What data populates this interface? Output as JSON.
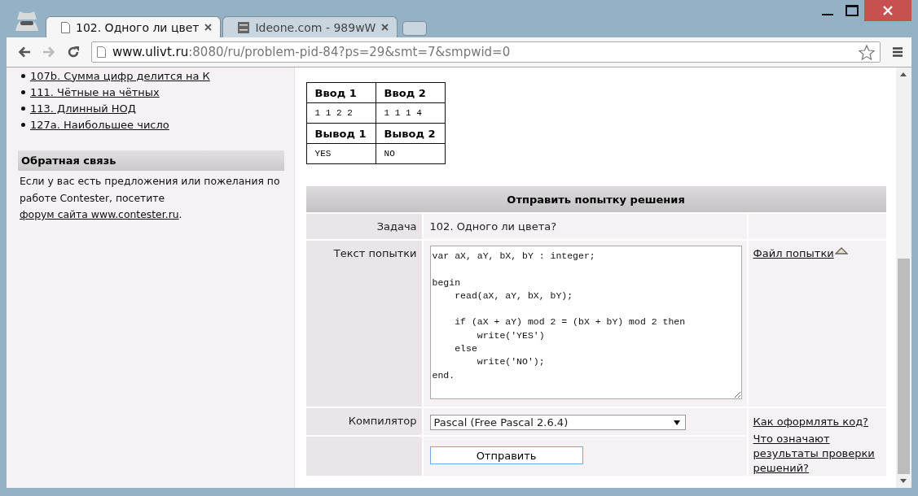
{
  "tabs": [
    {
      "title": "102. Одного ли цвет",
      "selected": true,
      "kind": "page"
    },
    {
      "title": "Ideone.com - 989wW",
      "selected": false,
      "kind": "ideone"
    }
  ],
  "address": {
    "host": "www.ulivt.ru",
    "rest": ":8080/ru/problem-pid-84?ps=29&smt=7&smpwid=0"
  },
  "sidebar": {
    "links": [
      "107b. Сумма цифр делится на К",
      "111. Чётные на чётных",
      "113. Длинный НОД",
      "127a. Наибольшее число"
    ],
    "feedback": {
      "title": "Обратная связь",
      "before": "Если у вас есть предложения или пожелания по работе Contester, посетите ",
      "link": "форум сайта www.contester.ru",
      "after": "."
    }
  },
  "samples": [
    {
      "kind": "header",
      "cells": [
        "Ввод 1",
        "Ввод 2"
      ]
    },
    {
      "kind": "data",
      "cells": [
        "1 1 2 2",
        "1 1 1 4"
      ]
    },
    {
      "kind": "header",
      "cells": [
        "Вывод 1",
        "Вывод 2"
      ]
    },
    {
      "kind": "data",
      "cells": [
        "YES",
        "NO"
      ]
    }
  ],
  "form": {
    "title": "Отправить попытку решения",
    "task_label": "Задача",
    "task_value": "102. Одного ли цвета?",
    "code_label": "Текст попытки",
    "code": "var aX, aY, bX, bY : integer;\n\nbegin\n    read(aX, aY, bX, bY);\n\n    if (aX + aY) mod 2 = (bX + bY) mod 2 then\n        write('YES')\n    else\n        write('NO');\nend.",
    "file_link": "Файл попытки",
    "compiler_label": "Компилятор",
    "compiler_value": "Pascal (Free Pascal 2.6.4)",
    "help_links": [
      "Как оформлять код?",
      "Что означают результаты проверки решений?"
    ],
    "submit": "Отправить"
  }
}
